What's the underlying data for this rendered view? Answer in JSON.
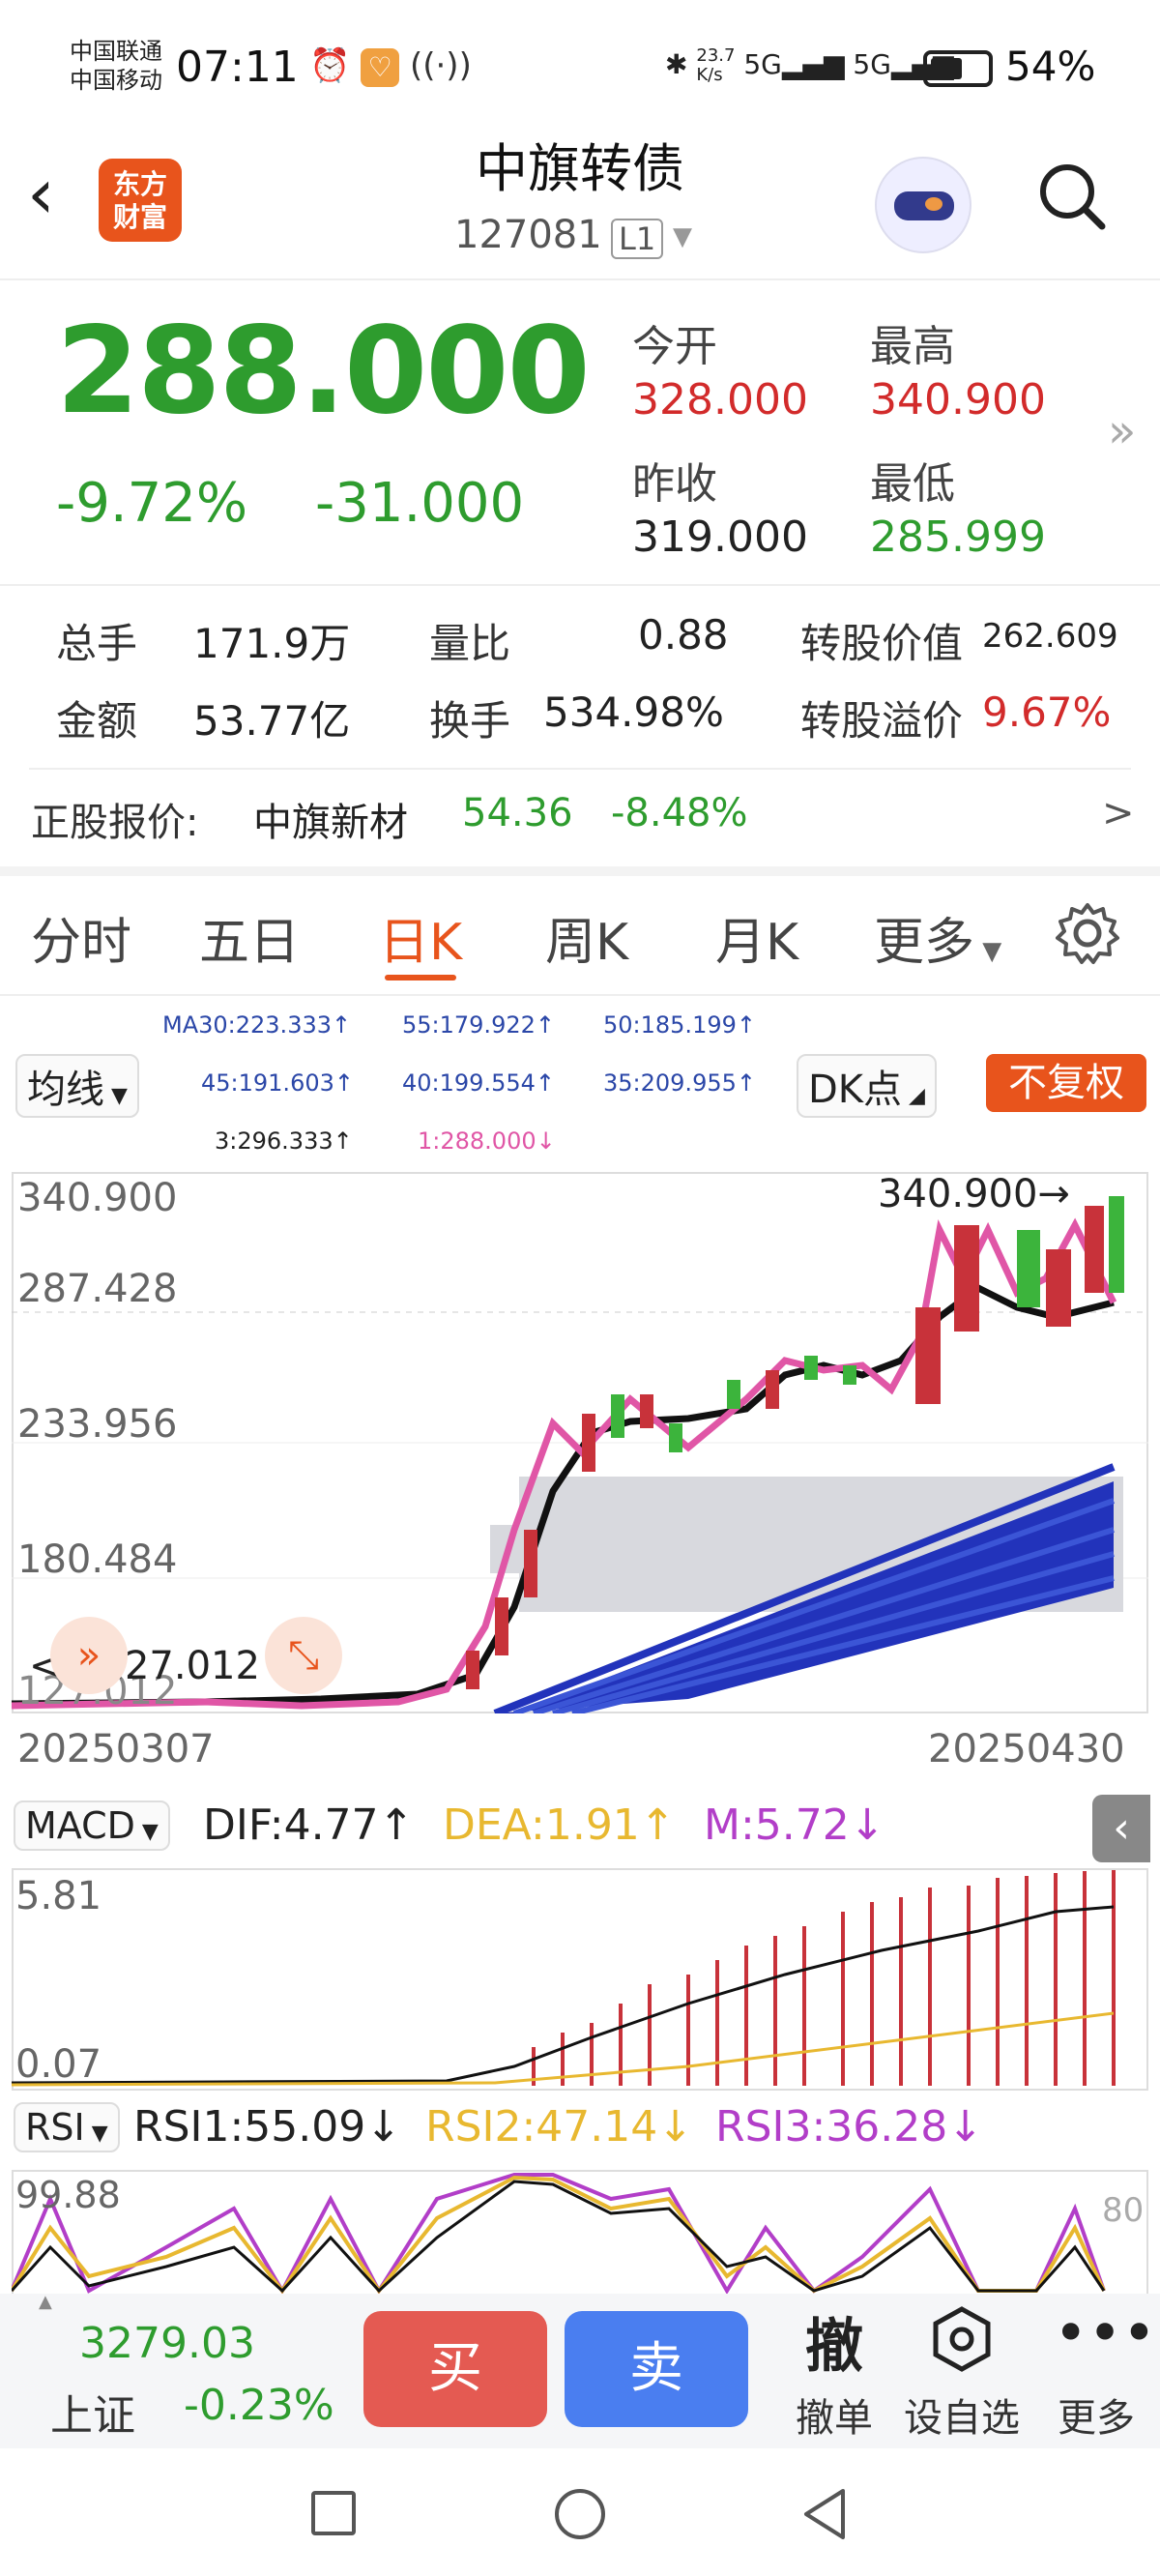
{
  "status": {
    "carrier1": "中国联通",
    "carrier2": "中国移动",
    "time": "07:11",
    "net_speed_top": "23.7",
    "net_speed_bottom": "K/s",
    "battery": "54%"
  },
  "header": {
    "logo": "东方\n财富",
    "title": "中旗转债",
    "code": "127081",
    "level": "L1"
  },
  "quote": {
    "price": "288.000",
    "change_pct": "-9.72%",
    "change": "-31.000",
    "open_label": "今开",
    "open": "328.000",
    "high_label": "最高",
    "high": "340.900",
    "prev_label": "昨收",
    "prev": "319.000",
    "low_label": "最低",
    "low": "285.999"
  },
  "stats": {
    "vol_label": "总手",
    "vol": "171.9万",
    "ratio_label": "量比",
    "ratio": "0.88",
    "conv_value_label": "转股价值",
    "conv_value": "262.609",
    "amount_label": "金额",
    "amount": "53.77亿",
    "turnover_label": "换手",
    "turnover": "534.98%",
    "premium_label": "转股溢价",
    "premium": "9.67%"
  },
  "underlying": {
    "label": "正股报价:",
    "name": "中旗新材",
    "price": "54.36",
    "change": "-8.48%",
    "arrow": ">"
  },
  "tabs": [
    "分时",
    "五日",
    "日K",
    "周K",
    "月K",
    "更多"
  ],
  "active_tab": "日K",
  "ma": {
    "ma30": "MA30:223.333↑",
    "ma55": "55:179.922↑",
    "ma50": "50:185.199↑",
    "ma45": "45:191.603↑",
    "ma40": "40:199.554↑",
    "ma35": "35:209.955↑",
    "ma3": "3:296.333↑",
    "ma1": "1:288.000↓",
    "selector": "均线",
    "dk": "DK点",
    "fuquan": "不复权"
  },
  "kchart": {
    "y_labels": [
      "340.900",
      "287.428",
      "233.956",
      "180.484",
      "127.012"
    ],
    "high_marker": "340.900",
    "low_marker": "127.012",
    "x_start": "20250307",
    "x_end": "20250430"
  },
  "macd": {
    "selector": "MACD",
    "dif": "DIF:4.77↑",
    "dea": "DEA:1.91↑",
    "m": "M:5.72↓",
    "y_top": "5.81",
    "y_bottom": "0.07"
  },
  "rsi": {
    "selector": "RSI",
    "rsi1": "RSI1:55.09↓",
    "rsi2": "RSI2:47.14↓",
    "rsi3": "RSI3:36.28↓",
    "y_top": "99.88",
    "level": "80"
  },
  "bottom": {
    "index_value": "3279.03",
    "index_name": "上证",
    "index_change": "-0.23%",
    "buy": "买",
    "sell": "卖",
    "cancel_icon": "撤",
    "cancel": "撤单",
    "watch": "设自选",
    "more": "更多"
  },
  "colors": {
    "up": "#d22b2b",
    "down": "#2e9c2e",
    "accent": "#e8541c"
  }
}
